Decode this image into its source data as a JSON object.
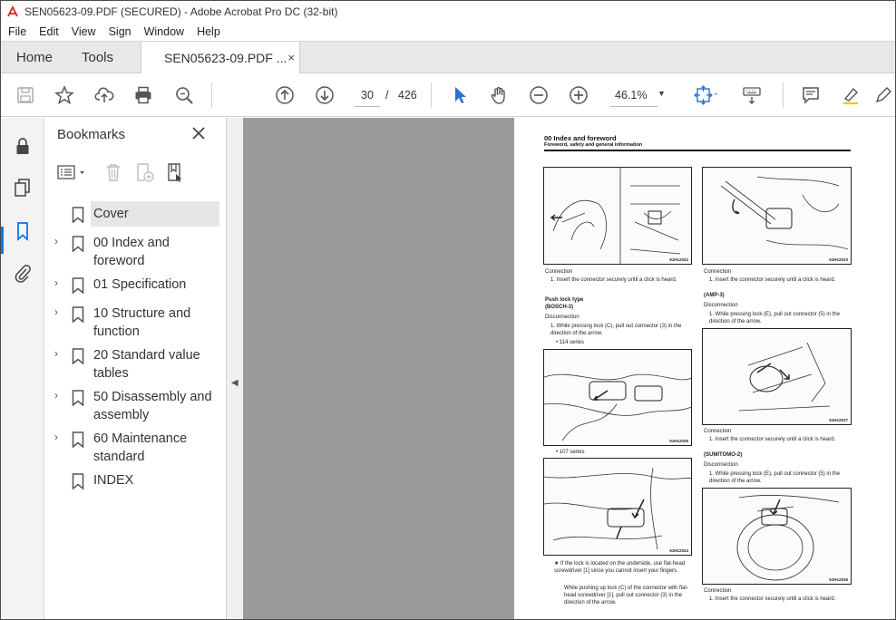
{
  "window": {
    "title": "SEN05623-09.PDF (SECURED) - Adobe Acrobat Pro DC (32-bit)"
  },
  "menu": [
    "File",
    "Edit",
    "View",
    "Sign",
    "Window",
    "Help"
  ],
  "tabs": {
    "home": "Home",
    "tools": "Tools",
    "document": "SEN05623-09.PDF ...",
    "close_glyph": "×"
  },
  "toolbar": {
    "current_page": "30",
    "page_separator": "/",
    "total_pages": "426",
    "zoom": "46.1%"
  },
  "bookmarks": {
    "title": "Bookmarks",
    "items": [
      {
        "label": "Cover",
        "expandable": false,
        "selected": true
      },
      {
        "label": "00 Index and foreword",
        "expandable": true
      },
      {
        "label": "01 Specification",
        "expandable": true
      },
      {
        "label": "10 Structure and function",
        "expandable": true
      },
      {
        "label": "20 Standard value tables",
        "expandable": true
      },
      {
        "label": "50 Disassembly and assembly",
        "expandable": true
      },
      {
        "label": "60 Maintenance standard",
        "expandable": true
      },
      {
        "label": "INDEX",
        "expandable": false
      }
    ]
  },
  "pdf_page": {
    "heading": "00 Index and foreword",
    "subheading": "Foreword, safety and general information",
    "figure_codes": [
      "9JH12022",
      "9JH12023",
      "9JH12025",
      "9JH12027",
      "9JH12024",
      "9JH12026"
    ],
    "left_col": {
      "connection": "Connection",
      "step1": "1.  Insert the connector securely until a click is heard.",
      "push_lock": "Push lock type",
      "bosch": "(BOSCH-3)",
      "disconnection": "Disconnection",
      "step_disc": "1.  While pressing lock (C), pull out connector (3) in the direction of the arrow.",
      "series114": "•  114 series",
      "series107": "•  107 series",
      "note1": "★  If the lock is located on the underside, use flat-head screwdriver [1] since you cannot insert your fingers.",
      "note2": "While pushing up lock (C) of the connector with flat-head screwdriver [1], pull out connector (3) in the direction of the arrow."
    },
    "right_col": {
      "connection": "Connection",
      "step1": "1.  Insert the connector securely until a click is heard.",
      "amp": "(AMP-3)",
      "disconnection": "Disconnection",
      "step_disc": "1.  While pressing lock (E), pull out connector (5) in the direction of the arrow.",
      "connection2": "Connection",
      "step2": "1.  Insert the connector securely until a click is heard.",
      "sumitomo": "(SUMITOMO-2)",
      "disconnection2": "Disconnection",
      "step_disc2": "1.  While pressing lock (E), pull out connector (5) in the direction of the arrow.",
      "connection3": "Connection",
      "step3": "1.  Insert the connector securely until a click is heard."
    }
  },
  "icons": [
    "pdf-app-icon",
    "save-icon",
    "bookmark-star-icon",
    "upload-icon",
    "print-icon",
    "search-zoom-icon",
    "page-up-icon",
    "page-down-icon",
    "select-cursor-icon",
    "hand-icon",
    "zoom-out-icon",
    "zoom-in-icon",
    "fit-page-icon",
    "keyboard-icon",
    "comment-icon",
    "highlight-icon",
    "pen-icon",
    "lock-icon",
    "pages-icon",
    "bookmark-icon",
    "attachment-icon"
  ],
  "colors": {
    "accent": "#1473e6",
    "acrobat_red": "#d7261e",
    "doc_bg": "#9a9a9a"
  }
}
